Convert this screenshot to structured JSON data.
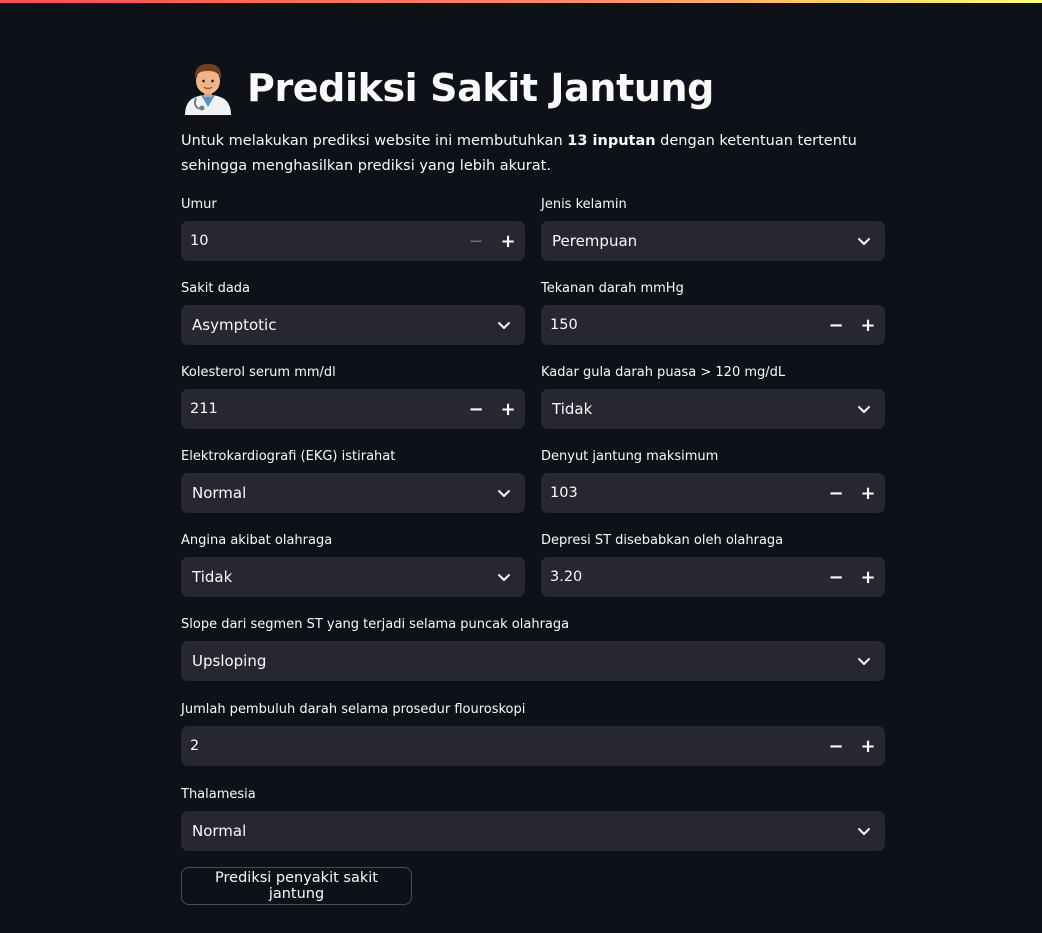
{
  "header": {
    "emoji_icon": "health-worker-emoji-icon",
    "title": "Prediksi Sakit Jantung"
  },
  "intro": {
    "before": "Untuk melakukan prediksi website ini membutuhkan ",
    "bold": "13 inputan",
    "after": " dengan ketentuan tertentu sehingga menghasilkan prediksi yang lebih akurat."
  },
  "form": {
    "umur": {
      "label": "Umur",
      "value": "10"
    },
    "jenis_kelamin": {
      "label": "Jenis kelamin",
      "value": "Perempuan"
    },
    "sakit_dada": {
      "label": "Sakit dada",
      "value": "Asymptotic"
    },
    "tekanan_darah": {
      "label": "Tekanan darah mmHg",
      "value": "150"
    },
    "kolesterol": {
      "label": "Kolesterol serum mm/dl",
      "value": "211"
    },
    "gula_darah": {
      "label": "Kadar gula darah puasa > 120 mg/dL",
      "value": "Tidak"
    },
    "ekg": {
      "label": "Elektrokardiografi (EKG) istirahat",
      "value": "Normal"
    },
    "denyut_jantung": {
      "label": "Denyut jantung maksimum",
      "value": "103"
    },
    "angina": {
      "label": "Angina akibat olahraga",
      "value": "Tidak"
    },
    "depresi_st": {
      "label": "Depresi ST disebabkan oleh olahraga",
      "value": "3.20"
    },
    "slope": {
      "label": "Slope dari segmen ST yang terjadi selama puncak olahraga",
      "value": "Upsloping"
    },
    "pembuluh": {
      "label": "Jumlah pembuluh darah selama prosedur flouroskopi",
      "value": "2"
    },
    "thalamesia": {
      "label": "Thalamesia",
      "value": "Normal"
    }
  },
  "stepper": {
    "minus": "−",
    "plus": "+"
  },
  "submit_label": "Prediksi penyakit sakit jantung",
  "colors": {
    "background": "#0e1117",
    "input_background": "#262730",
    "text": "#fafafa",
    "top_gradient_start": "#ff4b4b",
    "top_gradient_end": "#fffd80"
  }
}
